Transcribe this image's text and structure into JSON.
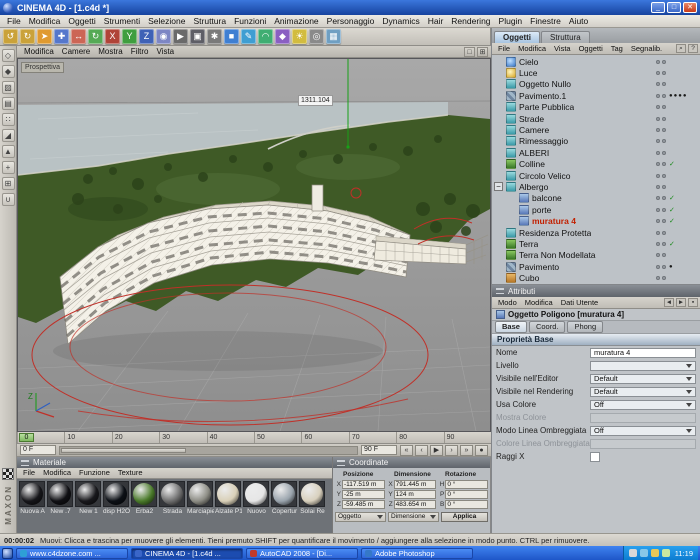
{
  "window": {
    "title": "CINEMA 4D - [1.c4d *]",
    "controls": {
      "min": "_",
      "max": "□",
      "close": "✕"
    }
  },
  "menubar": {
    "items": [
      "File",
      "Modifica",
      "Oggetti",
      "Strumenti",
      "Selezione",
      "Struttura",
      "Funzioni",
      "Animazione",
      "Personaggio",
      "Dynamics",
      "Hair",
      "Rendering",
      "Plugin",
      "Finestre",
      "Aiuto"
    ]
  },
  "toolbar": {
    "icons": [
      {
        "name": "undo-icon",
        "glyph": "↺",
        "bg": "#caa23a"
      },
      {
        "name": "redo-icon",
        "glyph": "↻",
        "bg": "#caa23a"
      },
      {
        "name": "live-selection-icon",
        "glyph": "➤",
        "bg": "#e09a30"
      },
      {
        "name": "move-icon",
        "glyph": "✚",
        "bg": "#5577cc"
      },
      {
        "name": "scale-icon",
        "glyph": "↔",
        "bg": "#cc6655"
      },
      {
        "name": "rotate-icon",
        "glyph": "↻",
        "bg": "#55aa55"
      },
      {
        "name": "lock-x-axis-icon",
        "glyph": "X",
        "bg": "#b04438"
      },
      {
        "name": "lock-y-axis-icon",
        "glyph": "Y",
        "bg": "#3f9e3f"
      },
      {
        "name": "lock-z-axis-icon",
        "glyph": "Z",
        "bg": "#3f62b6"
      },
      {
        "name": "coordinate-system-icon",
        "glyph": "◉",
        "bg": "#7d86c4"
      },
      {
        "name": "render-view-icon",
        "glyph": "▶",
        "bg": "#6a6a6a"
      },
      {
        "name": "render-picture-viewer-icon",
        "glyph": "▣",
        "bg": "#5e5e66"
      },
      {
        "name": "render-settings-icon",
        "glyph": "✱",
        "bg": "#7a7a7a"
      },
      {
        "name": "add-primitive-cube-icon",
        "glyph": "■",
        "bg": "#3f7fd2"
      },
      {
        "name": "spline-pen-icon",
        "glyph": "✎",
        "bg": "#3f9ed2"
      },
      {
        "name": "nurbs-icon",
        "glyph": "◠",
        "bg": "#3fae72"
      },
      {
        "name": "modeling-objects-icon",
        "glyph": "◆",
        "bg": "#8a5fc2"
      },
      {
        "name": "scene-light-icon",
        "glyph": "☀",
        "bg": "#d2bc3f"
      },
      {
        "name": "camera-icon",
        "glyph": "◎",
        "bg": "#8a8a8a"
      },
      {
        "name": "display-mode-icon",
        "glyph": "▦",
        "bg": "#6f9fc2"
      }
    ]
  },
  "left_toolbar": {
    "logo": "MAXON",
    "icons": [
      {
        "name": "model-mode-icon",
        "glyph": "◇"
      },
      {
        "name": "object-mode-icon",
        "glyph": "◆"
      },
      {
        "name": "texture-mode-icon",
        "glyph": "▨"
      },
      {
        "name": "workplane-mode-icon",
        "glyph": "▤"
      },
      {
        "name": "points-mode-icon",
        "glyph": "∷"
      },
      {
        "name": "edges-mode-icon",
        "glyph": "◢"
      },
      {
        "name": "polygons-mode-icon",
        "glyph": "▲"
      },
      {
        "name": "object-axis-icon",
        "glyph": "+"
      },
      {
        "name": "texture-axis-icon",
        "glyph": "⊞"
      },
      {
        "name": "snap-settings-icon",
        "glyph": "∪"
      }
    ]
  },
  "viewport": {
    "menu": [
      "Modifica",
      "Camere",
      "Mostra",
      "Filtro",
      "Vista"
    ],
    "view_label": "Prospettiva",
    "measure_label": "1311.104",
    "axis_label": "Z",
    "view_icons": [
      {
        "name": "single-view-icon",
        "glyph": "□"
      },
      {
        "name": "four-views-icon",
        "glyph": "⊞"
      }
    ]
  },
  "timeline": {
    "ticks": [
      "0",
      "10",
      "20",
      "30",
      "40",
      "50",
      "60",
      "70",
      "80",
      "90"
    ],
    "current": "0",
    "range_start": "0 F",
    "range_end": "90 F",
    "transport": [
      {
        "name": "go-to-start-icon",
        "glyph": "«"
      },
      {
        "name": "previous-frame-icon",
        "glyph": "‹"
      },
      {
        "name": "play-icon",
        "glyph": "▶"
      },
      {
        "name": "next-frame-icon",
        "glyph": "›"
      },
      {
        "name": "go-to-end-icon",
        "glyph": "»"
      },
      {
        "name": "record-key-icon",
        "glyph": "●"
      }
    ]
  },
  "materials": {
    "title": "Materiale",
    "menu": [
      "File",
      "Modifica",
      "Funzione",
      "Texture"
    ],
    "items": [
      {
        "label": "Nuova A",
        "color": "#16161a"
      },
      {
        "label": "New .7",
        "color": "#101014"
      },
      {
        "label": "New 1",
        "color": "#18181c"
      },
      {
        "label": "disp H2O",
        "color": "#0c1016"
      },
      {
        "label": "Erba2",
        "color": "#4a7a2a"
      },
      {
        "label": "Strada",
        "color": "#6f6f6f"
      },
      {
        "label": "Marciapie",
        "color": "#8d8d85"
      },
      {
        "label": "Alzate P1",
        "color": "#d9d0b8"
      },
      {
        "label": "Nuovo",
        "color": "#e6e6e6"
      },
      {
        "label": "Copertur",
        "color": "#9aa4ad"
      },
      {
        "label": "Solai Re",
        "color": "#d8d0bd"
      }
    ]
  },
  "coordinates": {
    "title": "Coordinate",
    "col_headers": [
      "Posizione",
      "Dimensione",
      "Rotazione"
    ],
    "rows": [
      {
        "l1": "X",
        "v1": "-117.519 m",
        "l2": "X",
        "v2": "791.445 m",
        "l3": "H",
        "v3": "0 °"
      },
      {
        "l1": "Y",
        "v1": "-25 m",
        "l2": "Y",
        "v2": "124 m",
        "l3": "P",
        "v3": "0 °"
      },
      {
        "l1": "Z",
        "v1": "-59.485 m",
        "l2": "Z",
        "v2": "483.654 m",
        "l3": "B",
        "v3": "0 °"
      }
    ],
    "footer": {
      "object": "Oggetto",
      "size": "Dimensione",
      "apply": "Applica"
    }
  },
  "object_manager": {
    "tabs": [
      {
        "label": "Oggetti",
        "cls": "active"
      },
      {
        "label": "Struttura",
        "cls": ""
      }
    ],
    "menu": [
      "File",
      "Modifica",
      "Vista",
      "Oggetti",
      "Tag",
      "Segnalib."
    ],
    "menu_icons": [
      {
        "name": "search-icon",
        "glyph": "⌕"
      },
      {
        "name": "help-icon",
        "glyph": "?"
      }
    ],
    "items": [
      {
        "label": "Cielo",
        "icon": "ic-sky"
      },
      {
        "label": "Luce",
        "icon": "ic-light"
      },
      {
        "label": "Oggetto Nullo",
        "icon": "ic-null"
      },
      {
        "label": "Pavimento.1",
        "icon": "ic-floor",
        "tags": "●●●●",
        "tagcls": "t-dark"
      },
      {
        "label": "Parte Pubblica",
        "icon": "ic-null"
      },
      {
        "label": "Strade",
        "icon": "ic-null"
      },
      {
        "label": "Camere",
        "icon": "ic-null"
      },
      {
        "label": "Rimessaggio",
        "icon": "ic-null"
      },
      {
        "label": "ALBERI",
        "icon": "ic-null"
      },
      {
        "label": "Colline",
        "icon": "ic-terrain",
        "tags": "✓",
        "tagcls": "t-green"
      },
      {
        "label": "Circolo Velico",
        "icon": "ic-null"
      },
      {
        "label": "Albergo",
        "icon": "ic-null",
        "exp": "−"
      },
      {
        "label": "balcone",
        "icon": "ic-poly",
        "cls": "child",
        "tags": "✓",
        "tagcls": "t-green"
      },
      {
        "label": "porte",
        "icon": "ic-poly",
        "cls": "child",
        "tags": "✓",
        "tagcls": "t-green"
      },
      {
        "label": "muratura 4",
        "icon": "ic-poly",
        "cls": "child selected",
        "tags": "✓",
        "tagcls": "t-green"
      },
      {
        "label": "Residenza Protetta",
        "icon": "ic-null"
      },
      {
        "label": "Terra",
        "icon": "ic-terrain",
        "tags": "✓",
        "tagcls": "t-green"
      },
      {
        "label": "Terra Non Modellata",
        "icon": "ic-terrain"
      },
      {
        "label": "Pavimento",
        "icon": "ic-floor",
        "tags": "●",
        "tagcls": "t-dark"
      },
      {
        "label": "Cubo",
        "icon": "ic-cube"
      }
    ]
  },
  "attributes": {
    "title": "Attributi",
    "menu": [
      "Modo",
      "Modifica",
      "Dati Utente"
    ],
    "menu_icons": [
      {
        "name": "back-icon",
        "glyph": "◄"
      },
      {
        "name": "forward-icon",
        "glyph": "►"
      },
      {
        "name": "lock-icon",
        "glyph": "▪"
      }
    ],
    "object_title": "Oggetto Poligono [muratura 4]",
    "tabs": [
      {
        "label": "Base",
        "cls": "active"
      },
      {
        "label": "Coord.",
        "cls": ""
      },
      {
        "label": "Phong",
        "cls": ""
      }
    ],
    "section": "Proprietà Base",
    "rows": [
      {
        "label": "Nome",
        "value": "muratura 4",
        "type": "text"
      },
      {
        "label": "Livello",
        "value": "",
        "type": "dropdown"
      },
      {
        "label": "Visibile nell'Editor",
        "value": "Default",
        "type": "dropdown"
      },
      {
        "label": "Visibile nel Rendering",
        "value": "Default",
        "type": "dropdown"
      },
      {
        "label": "Usa Colore",
        "value": "Off",
        "type": "dropdown"
      },
      {
        "label": "Mostra Colore",
        "value": "",
        "type": "swatch_dis"
      },
      {
        "label": "Modo Linea Ombreggiata",
        "value": "Off",
        "type": "dropdown"
      },
      {
        "label": "Colore Linea Ombreggiata",
        "value": "",
        "type": "swatch_dis"
      },
      {
        "label": "Raggi X",
        "value": "",
        "type": "checkbox"
      }
    ]
  },
  "status_bar": {
    "time": "00:00:02",
    "message": "Muovi: Clicca e trascina per muovere gli elementi. Tieni premuto SHIFT per quantificare il movimento / aggiungere alla selezione in modo punto. CTRL per rimuovere."
  },
  "taskbar": {
    "buttons": [
      {
        "label": "www.c4dzone.com ...",
        "color": "#2e9fd6",
        "cls": ""
      },
      {
        "label": "CINEMA 4D - [1.c4d ...",
        "color": "#3a66c8",
        "cls": "active"
      },
      {
        "label": "AutoCAD 2008 - [Di...",
        "color": "#c23a2a",
        "cls": ""
      },
      {
        "label": "Adobe Photoshop",
        "color": "#3578c8",
        "cls": ""
      }
    ],
    "tray_icons": [
      {
        "name": "volume-icon",
        "color": "#d8d8d8"
      },
      {
        "name": "display-icon",
        "color": "#88c8e8"
      },
      {
        "name": "network-icon",
        "color": "#e8c858"
      },
      {
        "name": "antivirus-icon",
        "color": "#c8e8a0"
      }
    ],
    "clock": "11:19"
  }
}
